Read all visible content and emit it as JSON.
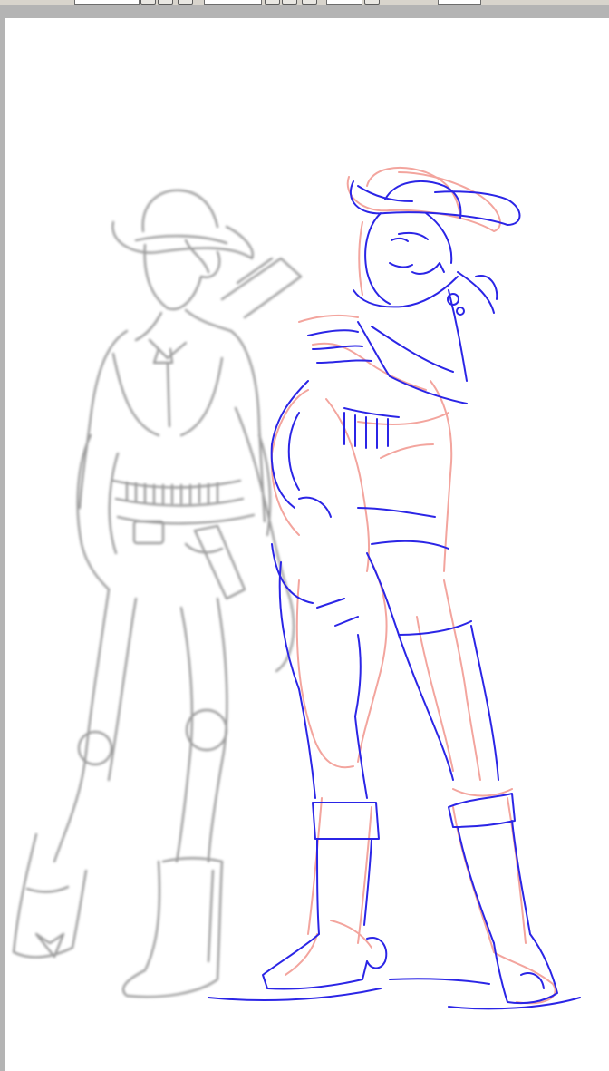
{
  "toolbar": {
    "label_left": "",
    "label_right": "",
    "controls": [
      "field-a",
      "field-b",
      "field-c",
      "field-d"
    ]
  },
  "canvas": {
    "layers": [
      {
        "name": "background-figure",
        "color": "#9a9a9a"
      },
      {
        "name": "rough-sketch",
        "color": "#f2a7a0"
      },
      {
        "name": "lineart-sketch",
        "color": "#2a24e8"
      }
    ]
  }
}
